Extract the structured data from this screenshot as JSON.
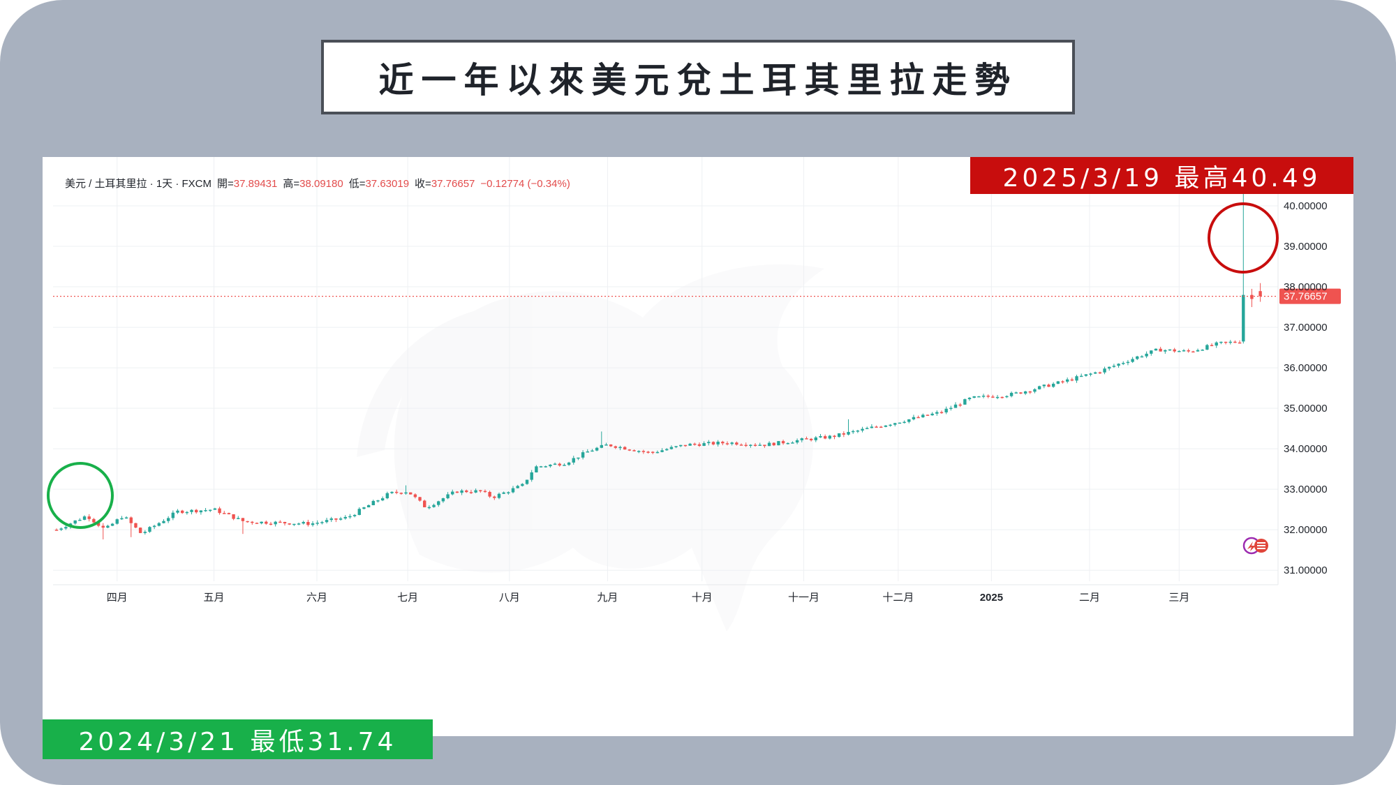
{
  "title": "近一年以來美元兌土耳其里拉走勢",
  "info": {
    "symbol": "美元 / 土耳其里拉 · 1天 · FXCM",
    "open_label": "開=",
    "open_value": "37.89431",
    "high_label": "高=",
    "high_value": "38.09180",
    "low_label": "低=",
    "low_value": "37.63019",
    "close_label": "收=",
    "close_value": "37.76657",
    "change": "−0.12774 (−0.34%)"
  },
  "annotations": {
    "high": "2025/3/19 最高40.49",
    "low": "2024/3/21 最低31.74"
  },
  "colors": {
    "up": "#26a69a",
    "down": "#ef5350",
    "high_banner": "#c80d0d",
    "low_banner": "#18b04a"
  },
  "chart_data": {
    "type": "candlestick",
    "title": "近一年以來美元兌土耳其里拉走勢",
    "xlabel": "",
    "ylabel": "",
    "ylim": [
      30.9,
      41.0
    ],
    "grid": true,
    "y_ticks": [
      "31.00000",
      "32.00000",
      "33.00000",
      "34.00000",
      "35.00000",
      "36.00000",
      "37.00000",
      "38.00000",
      "39.00000",
      "40.00000"
    ],
    "y_tick_values": [
      31,
      32,
      33,
      34,
      35,
      36,
      37,
      38,
      39,
      40
    ],
    "x_ticks": [
      {
        "label": "四月",
        "t": 0.05
      },
      {
        "label": "五月",
        "t": 0.13
      },
      {
        "label": "六月",
        "t": 0.215
      },
      {
        "label": "七月",
        "t": 0.29
      },
      {
        "label": "八月",
        "t": 0.374
      },
      {
        "label": "九月",
        "t": 0.455
      },
      {
        "label": "十月",
        "t": 0.533
      },
      {
        "label": "十一月",
        "t": 0.617
      },
      {
        "label": "十二月",
        "t": 0.695
      },
      {
        "label": "2025",
        "t": 0.772
      },
      {
        "label": "二月",
        "t": 0.853
      },
      {
        "label": "三月",
        "t": 0.927
      }
    ],
    "current_price": 37.76657,
    "current_price_label": "37.76657",
    "anchors": [
      {
        "t": 0.0,
        "v": 32.0
      },
      {
        "t": 0.025,
        "v": 32.35
      },
      {
        "t": 0.04,
        "v": 32.0
      },
      {
        "t": 0.055,
        "v": 32.35
      },
      {
        "t": 0.07,
        "v": 31.9
      },
      {
        "t": 0.1,
        "v": 32.45
      },
      {
        "t": 0.13,
        "v": 32.5
      },
      {
        "t": 0.155,
        "v": 32.2
      },
      {
        "t": 0.21,
        "v": 32.15
      },
      {
        "t": 0.24,
        "v": 32.3
      },
      {
        "t": 0.275,
        "v": 32.9
      },
      {
        "t": 0.29,
        "v": 32.95
      },
      {
        "t": 0.305,
        "v": 32.55
      },
      {
        "t": 0.33,
        "v": 32.95
      },
      {
        "t": 0.35,
        "v": 32.95
      },
      {
        "t": 0.36,
        "v": 32.8
      },
      {
        "t": 0.385,
        "v": 33.1
      },
      {
        "t": 0.395,
        "v": 33.55
      },
      {
        "t": 0.42,
        "v": 33.65
      },
      {
        "t": 0.44,
        "v": 33.95
      },
      {
        "t": 0.455,
        "v": 34.1
      },
      {
        "t": 0.49,
        "v": 33.9
      },
      {
        "t": 0.52,
        "v": 34.1
      },
      {
        "t": 0.555,
        "v": 34.15
      },
      {
        "t": 0.585,
        "v": 34.1
      },
      {
        "t": 0.61,
        "v": 34.2
      },
      {
        "t": 0.64,
        "v": 34.3
      },
      {
        "t": 0.67,
        "v": 34.5
      },
      {
        "t": 0.7,
        "v": 34.7
      },
      {
        "t": 0.73,
        "v": 34.9
      },
      {
        "t": 0.755,
        "v": 35.25
      },
      {
        "t": 0.79,
        "v": 35.35
      },
      {
        "t": 0.83,
        "v": 35.65
      },
      {
        "t": 0.86,
        "v": 35.9
      },
      {
        "t": 0.895,
        "v": 36.3
      },
      {
        "t": 0.91,
        "v": 36.45
      },
      {
        "t": 0.935,
        "v": 36.4
      },
      {
        "t": 0.96,
        "v": 36.6
      },
      {
        "t": 0.977,
        "v": 36.65
      }
    ],
    "final_candles": [
      {
        "t": 0.98,
        "open": 36.65,
        "high": 40.49,
        "low": 36.6,
        "close": 37.8
      },
      {
        "t": 0.987,
        "open": 37.8,
        "high": 37.95,
        "low": 37.5,
        "close": 37.7
      },
      {
        "t": 0.994,
        "open": 37.89431,
        "high": 38.0918,
        "low": 37.63019,
        "close": 37.76657
      }
    ]
  }
}
